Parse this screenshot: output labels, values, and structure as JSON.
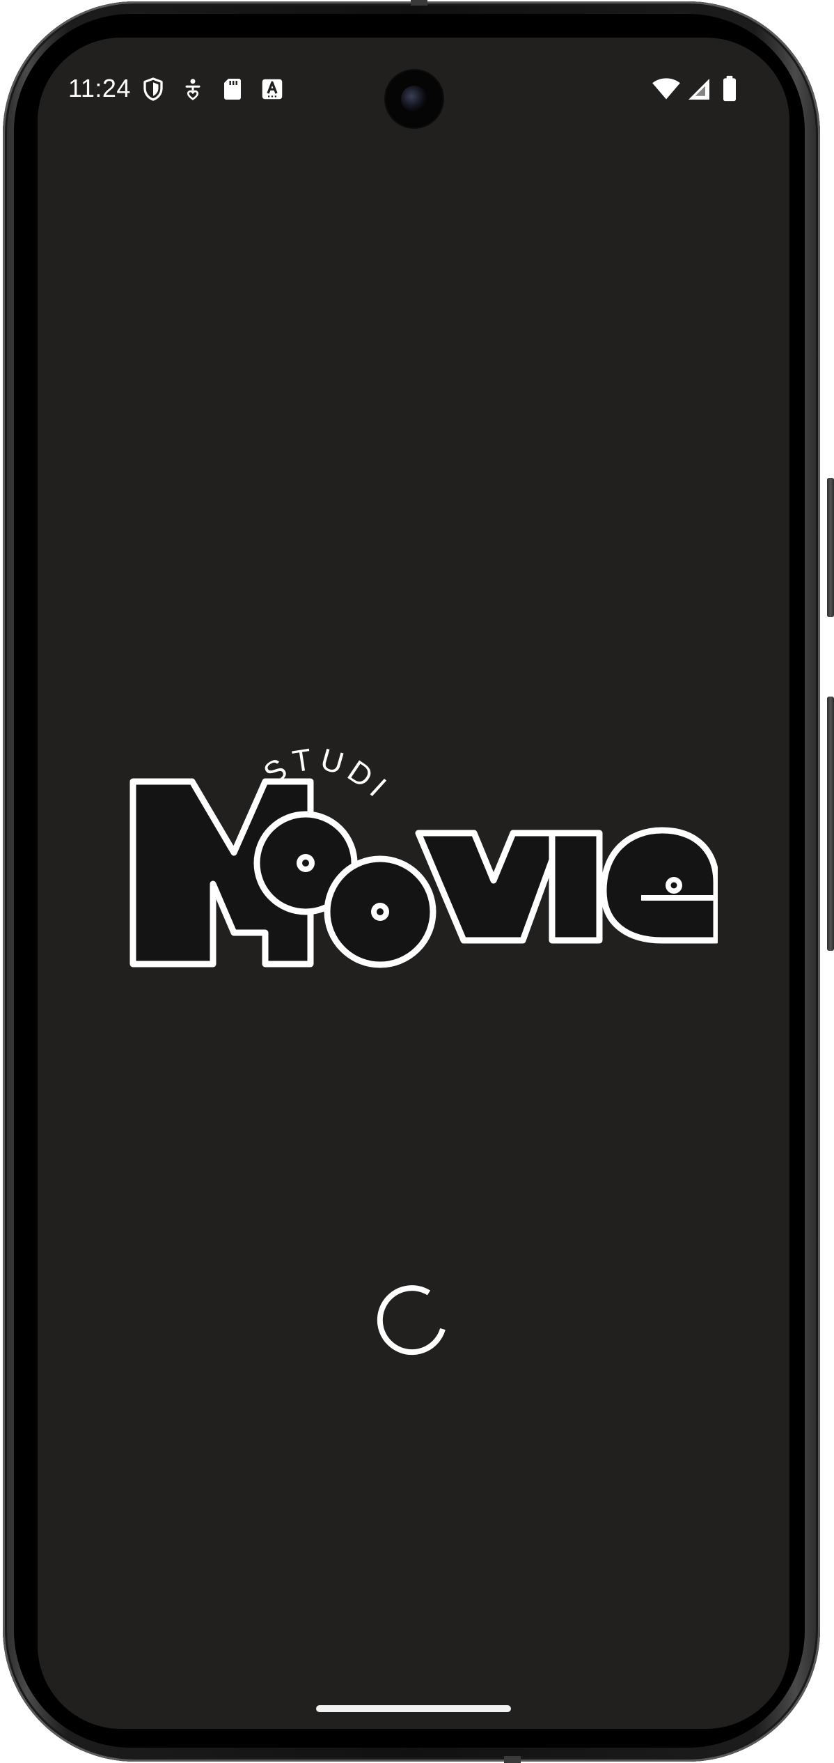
{
  "status_bar": {
    "time": "11:24",
    "left_icons": [
      "shield-icon",
      "accessibility-icon",
      "sd-card-icon",
      "keyboard-a-icon"
    ],
    "right_icons": [
      "wifi-icon",
      "cellular-signal-icon",
      "battery-icon"
    ]
  },
  "splash": {
    "logo_top_text": "STUDIO",
    "logo_main_text": "Moovie",
    "loading": true
  },
  "colors": {
    "screen_background": "#21201f",
    "logo_fill": "#141414",
    "logo_outline": "#ffffff",
    "foreground": "#ffffff"
  }
}
